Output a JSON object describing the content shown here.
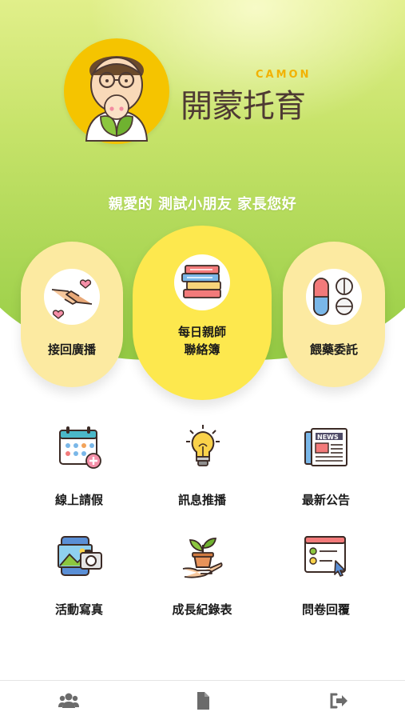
{
  "app": {
    "brand_en": "CAMON",
    "brand_zh": "開蒙托育",
    "greeting": "親愛的 測試小朋友 家長您好",
    "colors": {
      "accent_yellow": "#fde84e",
      "pill_yellow": "#fceaa1",
      "logo_yellow": "#f5c400",
      "green": "#96cd45"
    }
  },
  "features": [
    {
      "label": "接回廣播",
      "icon": "hands-hearts-icon"
    },
    {
      "label": "每日親師\n聯絡簿",
      "line1": "每日親師",
      "line2": "聯絡簿",
      "icon": "books-icon"
    },
    {
      "label": "餵藥委託",
      "icon": "medicine-pills-icon"
    }
  ],
  "grid": [
    {
      "label": "線上請假",
      "icon": "calendar-add-icon"
    },
    {
      "label": "訊息推播",
      "icon": "lightbulb-icon"
    },
    {
      "label": "最新公告",
      "icon": "newspaper-icon"
    },
    {
      "label": "活動寫真",
      "icon": "photo-camera-icon"
    },
    {
      "label": "成長紀錄表",
      "icon": "plant-hand-icon"
    },
    {
      "label": "問卷回覆",
      "icon": "survey-form-icon"
    }
  ],
  "tabbar": [
    {
      "name": "users",
      "icon": "users-icon"
    },
    {
      "name": "document",
      "icon": "document-icon"
    },
    {
      "name": "logout",
      "icon": "logout-icon"
    }
  ]
}
